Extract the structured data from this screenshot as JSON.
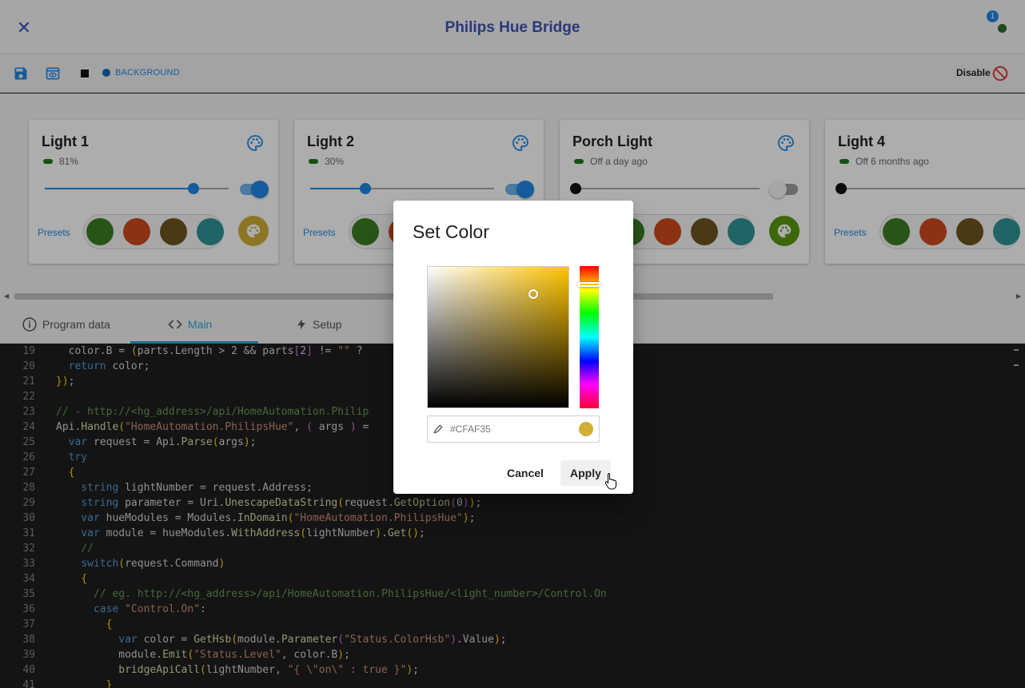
{
  "app": {
    "title": "Philips Hue Bridge",
    "notification_count": "1"
  },
  "toolbar": {
    "background_label": "BACKGROUND",
    "disable_label": "Disable"
  },
  "colors": {
    "accent": "#1e88e5",
    "title": "#3f51b5",
    "tab_active": "#29a3df",
    "status_on": "#1b7a1b",
    "disable": "#e53935"
  },
  "cards": [
    {
      "name": "Light 1",
      "status": "81%",
      "level": 81,
      "on": true,
      "presets_label": "Presets",
      "preset_colors": [
        "#3b7e23",
        "#cc4a1d",
        "#6e5520",
        "#2f9696"
      ],
      "current_color": "#cfaf35"
    },
    {
      "name": "Light 2",
      "status": "30%",
      "level": 30,
      "on": true,
      "presets_label": "Presets",
      "preset_colors": [
        "#3b7e23",
        "#cc4a1d",
        "#6e5520",
        "#2f9696"
      ],
      "current_color": "#cfaf35"
    },
    {
      "name": "Porch Light",
      "status": "Off a day ago",
      "level": 0,
      "on": false,
      "presets_label": "Presets",
      "preset_colors": [
        "#3b7e23",
        "#cc4a1d",
        "#6e5520",
        "#2f9696"
      ],
      "current_color": "#5a9a10"
    },
    {
      "name": "Light 4",
      "status": "Off 6 months ago",
      "level": 0,
      "on": false,
      "presets_label": "Presets",
      "preset_colors": [
        "#3b7e23",
        "#cc4a1d",
        "#6e5520",
        "#2f9696"
      ],
      "current_color": "#cfaf35"
    }
  ],
  "tabs": [
    {
      "label": "Program data",
      "icon": "info-icon",
      "active": false
    },
    {
      "label": "Main",
      "icon": "code-icon",
      "active": true
    },
    {
      "label": "Setup",
      "icon": "bolt-icon",
      "active": false
    }
  ],
  "code": [
    {
      "n": "19",
      "indent": 1,
      "html": "color.B = (parts.Length > 2 && parts[2] != \"\" ?"
    },
    {
      "n": "20",
      "indent": 1,
      "html": "return color;"
    },
    {
      "n": "21",
      "indent": 0,
      "html": "});"
    },
    {
      "n": "22",
      "indent": 0,
      "html": ""
    },
    {
      "n": "23",
      "indent": 0,
      "html": "// - http://<hg_address>/api/HomeAutomation.Philip"
    },
    {
      "n": "24",
      "indent": 0,
      "html": "Api.Handle(\"HomeAutomation.PhilipsHue\", ( args ) ="
    },
    {
      "n": "25",
      "indent": 1,
      "html": "var request = Api.Parse(args);"
    },
    {
      "n": "26",
      "indent": 1,
      "html": "try"
    },
    {
      "n": "27",
      "indent": 1,
      "html": "{"
    },
    {
      "n": "28",
      "indent": 2,
      "html": "string lightNumber = request.Address;"
    },
    {
      "n": "29",
      "indent": 2,
      "html": "string parameter = Uri.UnescapeDataString(request.GetOption(0));"
    },
    {
      "n": "30",
      "indent": 2,
      "html": "var hueModules = Modules.InDomain(\"HomeAutomation.PhilipsHue\");"
    },
    {
      "n": "31",
      "indent": 2,
      "html": "var module = hueModules.WithAddress(lightNumber).Get();"
    },
    {
      "n": "32",
      "indent": 2,
      "html": "//"
    },
    {
      "n": "33",
      "indent": 2,
      "html": "switch(request.Command)"
    },
    {
      "n": "34",
      "indent": 2,
      "html": "{"
    },
    {
      "n": "35",
      "indent": 3,
      "html": "// eg. http://<hg_address>/api/HomeAutomation.PhilipsHue/<light_number>/Control.On"
    },
    {
      "n": "36",
      "indent": 3,
      "html": "case \"Control.On\":"
    },
    {
      "n": "37",
      "indent": 4,
      "html": "{"
    },
    {
      "n": "38",
      "indent": 5,
      "html": "var color = GetHsb(module.Parameter(\"Status.ColorHsb\").Value);"
    },
    {
      "n": "39",
      "indent": 5,
      "html": "module.Emit(\"Status.Level\", color.B);"
    },
    {
      "n": "40",
      "indent": 5,
      "html": "bridgeApiCall(lightNumber, \"{ \\\"on\\\" : true }\");"
    },
    {
      "n": "41",
      "indent": 4,
      "html": "}"
    }
  ],
  "dialog": {
    "title": "Set Color",
    "hex_value": "",
    "hex_placeholder": "#CFAF35",
    "selected_color": "#cfaf35",
    "hue_fraction": 0.13,
    "saturation": 0.74,
    "brightness": 0.81,
    "cancel_label": "Cancel",
    "apply_label": "Apply"
  }
}
